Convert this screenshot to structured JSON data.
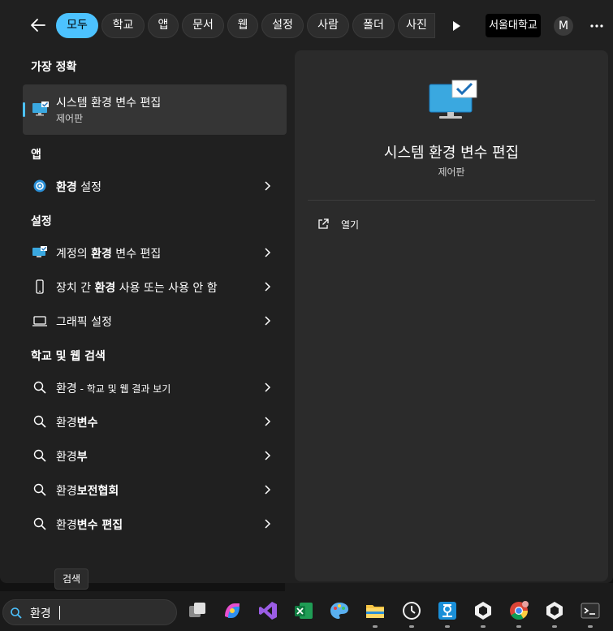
{
  "filters": {
    "chips": [
      "모두",
      "학교",
      "앱",
      "문서",
      "웹",
      "설정",
      "사람",
      "폴더",
      "사진"
    ],
    "organization": "서울대학교",
    "avatar_initial": "M"
  },
  "best_match": {
    "heading": "가장 정확",
    "title": "시스템 환경 변수 편집",
    "subtitle": "제어판"
  },
  "apps": {
    "heading": "앱",
    "items": [
      {
        "pre": "",
        "bold": "환경",
        "post": " 설정"
      }
    ]
  },
  "settings": {
    "heading": "설정",
    "items": [
      {
        "pre": "계정의 ",
        "bold": "환경",
        "post": " 변수 편집"
      },
      {
        "pre": "장치 간 ",
        "bold": "환경",
        "post": " 사용 또는 사용 안 함"
      },
      {
        "pre": "그래픽 설정",
        "bold": "",
        "post": ""
      }
    ]
  },
  "web": {
    "heading": "학교 및 웹 검색",
    "first": {
      "term": "환경",
      "suffix": " - 학교 및 웹 결과 보기"
    },
    "items": [
      {
        "pre": "환경",
        "bold": "변수"
      },
      {
        "pre": "환경",
        "bold": "부"
      },
      {
        "pre": "환경",
        "bold": "보전협회"
      },
      {
        "pre": "환경",
        "bold": "변수 편집"
      }
    ]
  },
  "preview": {
    "title": "시스템 환경 변수 편집",
    "subtitle": "제어판",
    "action": "열기"
  },
  "taskbar": {
    "tooltip": "검색",
    "search_value": "환경"
  },
  "colors": {
    "accent": "#4cc2ff",
    "panel": "#202020",
    "preview": "#2b2b2b"
  }
}
